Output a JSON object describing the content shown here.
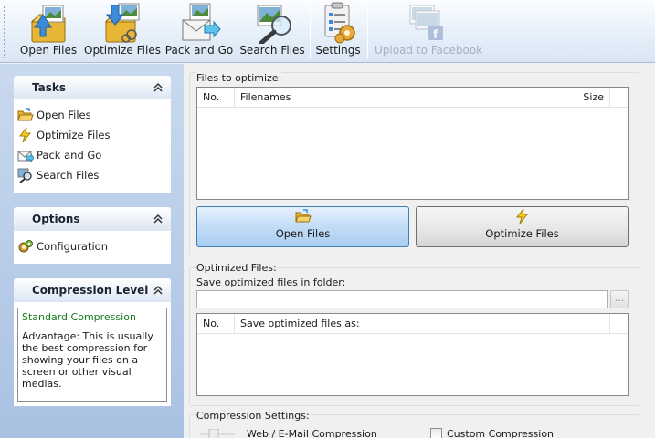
{
  "toolbar": {
    "buttons": [
      {
        "label": "Open Files",
        "icon": "open-files-icon",
        "enabled": true
      },
      {
        "label": "Optimize Files",
        "icon": "optimize-files-icon",
        "enabled": true
      },
      {
        "label": "Pack and Go",
        "icon": "pack-and-go-icon",
        "enabled": true
      },
      {
        "label": "Search Files",
        "icon": "search-files-icon",
        "enabled": true
      },
      {
        "label": "Settings",
        "icon": "settings-icon",
        "enabled": true
      },
      {
        "label": "Upload to Facebook",
        "icon": "facebook-upload-icon",
        "enabled": false
      }
    ]
  },
  "sidebar": {
    "tasks": {
      "title": "Tasks",
      "items": [
        {
          "label": "Open Files",
          "icon": "folder-icon"
        },
        {
          "label": "Optimize Files",
          "icon": "lightning-icon"
        },
        {
          "label": "Pack and Go",
          "icon": "envelope-icon"
        },
        {
          "label": "Search Files",
          "icon": "magnifier-icon"
        }
      ]
    },
    "options": {
      "title": "Options",
      "items": [
        {
          "label": "Configuration",
          "icon": "gears-icon"
        }
      ]
    },
    "compression": {
      "title": "Compression Level",
      "level_name": "Standard Compression",
      "description": "Advantage: This is usually the best compression for showing your files on a screen or other visual medias."
    }
  },
  "main": {
    "files_group": {
      "label": "Files to optimize:",
      "columns": [
        "No.",
        "Filenames",
        "Size"
      ],
      "rows": [],
      "open_button": "Open Files",
      "optimize_button": "Optimize Files"
    },
    "optimized_group": {
      "label": "Optimized Files:",
      "folder_label": "Save optimized files in folder:",
      "folder_value": "",
      "browse_label": "...",
      "columns": [
        "No.",
        "Save optimized files as:"
      ],
      "rows": []
    },
    "compression_settings": {
      "label": "Compression Settings:",
      "web_email": "Web / E-Mail Compression",
      "custom": "Custom Compression",
      "custom_checked": false
    }
  },
  "colors": {
    "toolbar_top": "#fbfdff",
    "toolbar_bottom": "#d9e6f5",
    "sidebar_bg": "#b9cde8",
    "compression_title": "#157c1d",
    "selected_button_border": "#3c7fb1"
  }
}
